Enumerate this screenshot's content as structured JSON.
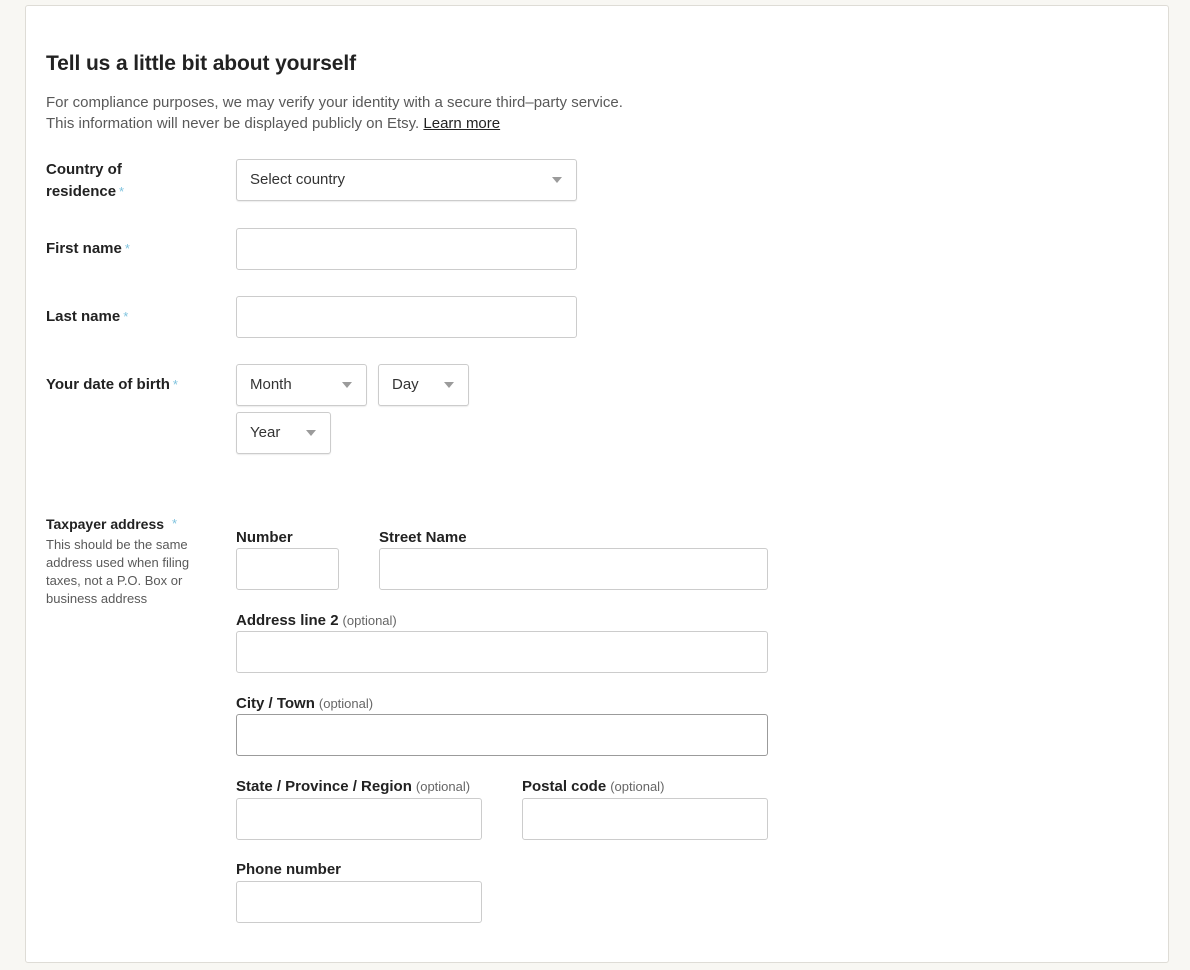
{
  "form": {
    "title": "Tell us a little bit about yourself",
    "intro_line1": "For compliance purposes, we may verify your identity with a secure third–party service.",
    "intro_line2": "This information will never be displayed publicly on Etsy.",
    "learn_more": "Learn more",
    "required_mark": "*",
    "country": {
      "label_line1": "Country of",
      "label_line2": "residence",
      "placeholder": "Select country"
    },
    "first_name": {
      "label": "First name",
      "value": ""
    },
    "last_name": {
      "label": "Last name",
      "value": ""
    },
    "dob": {
      "label": "Your date of birth",
      "month": "Month",
      "day": "Day",
      "year": "Year"
    },
    "address": {
      "label": "Taxpayer address",
      "hint": "This should be the same address used when filing taxes, not a P.O. Box or business address",
      "optional": "(optional)",
      "number_label": "Number",
      "street_label": "Street Name",
      "line2_label": "Address line 2",
      "city_label": "City / Town",
      "state_label": "State / Province / Region",
      "postal_label": "Postal code",
      "phone_label": "Phone number"
    }
  },
  "colors": {
    "background": "#f8f7f3",
    "required_asterisk": "#7fc3de",
    "border": "#cccccc"
  }
}
